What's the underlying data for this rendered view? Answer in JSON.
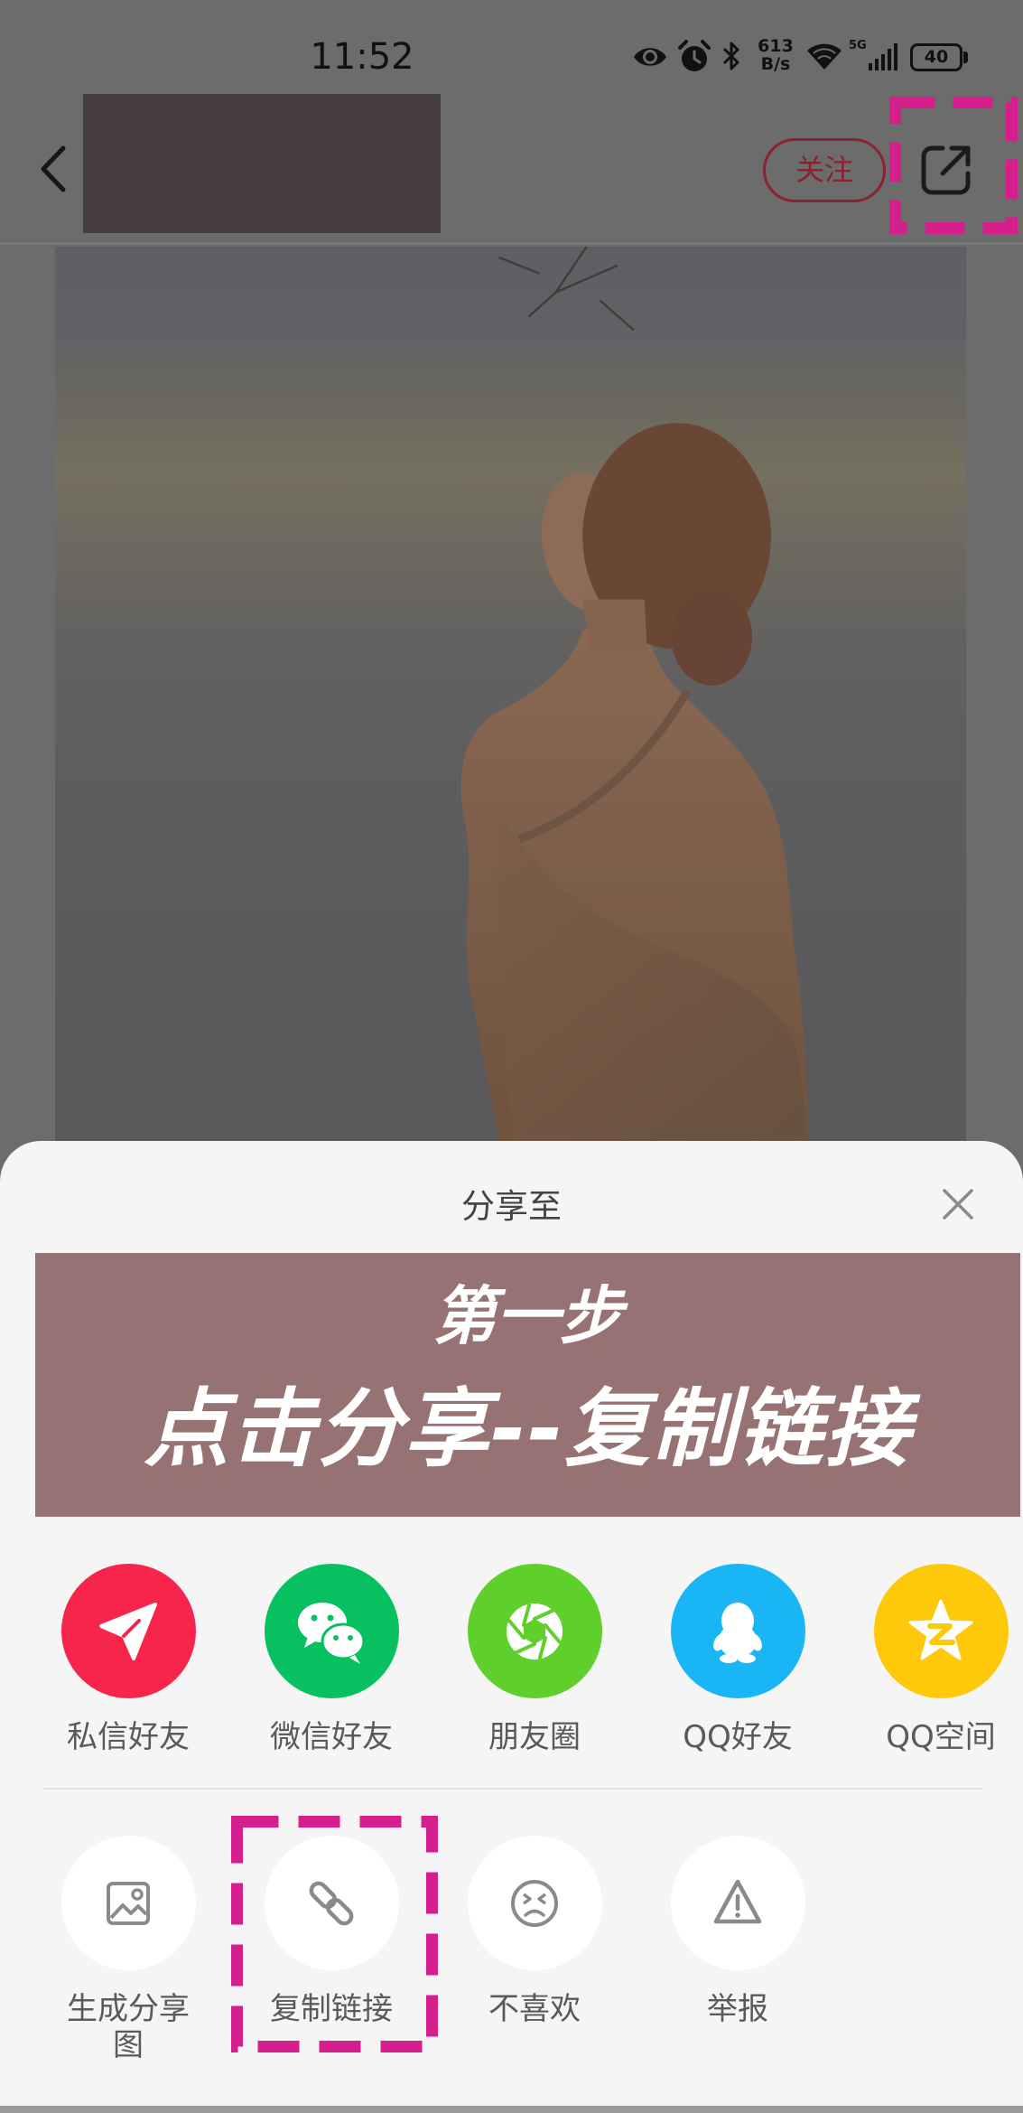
{
  "status_bar": {
    "time": "11:52",
    "speed_value": "613",
    "speed_unit": "B/s",
    "network_type": "5G",
    "battery_level": "40",
    "icons": [
      "eye-icon",
      "alarm-icon",
      "bluetooth-icon",
      "wifi-icon",
      "signal-icon",
      "battery-icon"
    ]
  },
  "header": {
    "back_icon": "chevron-left-icon",
    "follow_label": "关注",
    "share_icon": "share-external-icon"
  },
  "share_sheet": {
    "title": "分享至",
    "close_icon": "close-icon",
    "banner": {
      "line1": "第一步",
      "line2": "点击分享--复制链接",
      "background": "#967372"
    },
    "share_targets": [
      {
        "label": "私信好友",
        "icon": "paper-plane-icon",
        "color": "#f7244b"
      },
      {
        "label": "微信好友",
        "icon": "wechat-icon",
        "color": "#07c160"
      },
      {
        "label": "朋友圈",
        "icon": "moments-icon",
        "color": "#5fcf2c"
      },
      {
        "label": "QQ好友",
        "icon": "qq-icon",
        "color": "#19b5f5"
      },
      {
        "label": "QQ空间",
        "icon": "qzone-icon",
        "color": "#ffc90b"
      }
    ],
    "actions": [
      {
        "label": "生成分享图",
        "icon": "image-icon"
      },
      {
        "label": "复制链接",
        "icon": "link-icon"
      },
      {
        "label": "不喜欢",
        "icon": "dislike-face-icon"
      },
      {
        "label": "举报",
        "icon": "report-warning-icon"
      }
    ]
  },
  "colors": {
    "highlight": "#d41f8c",
    "dim_background": "#6c6c6c",
    "sheet_background": "#f5f5f5",
    "follow_accent": "#8d2232"
  }
}
